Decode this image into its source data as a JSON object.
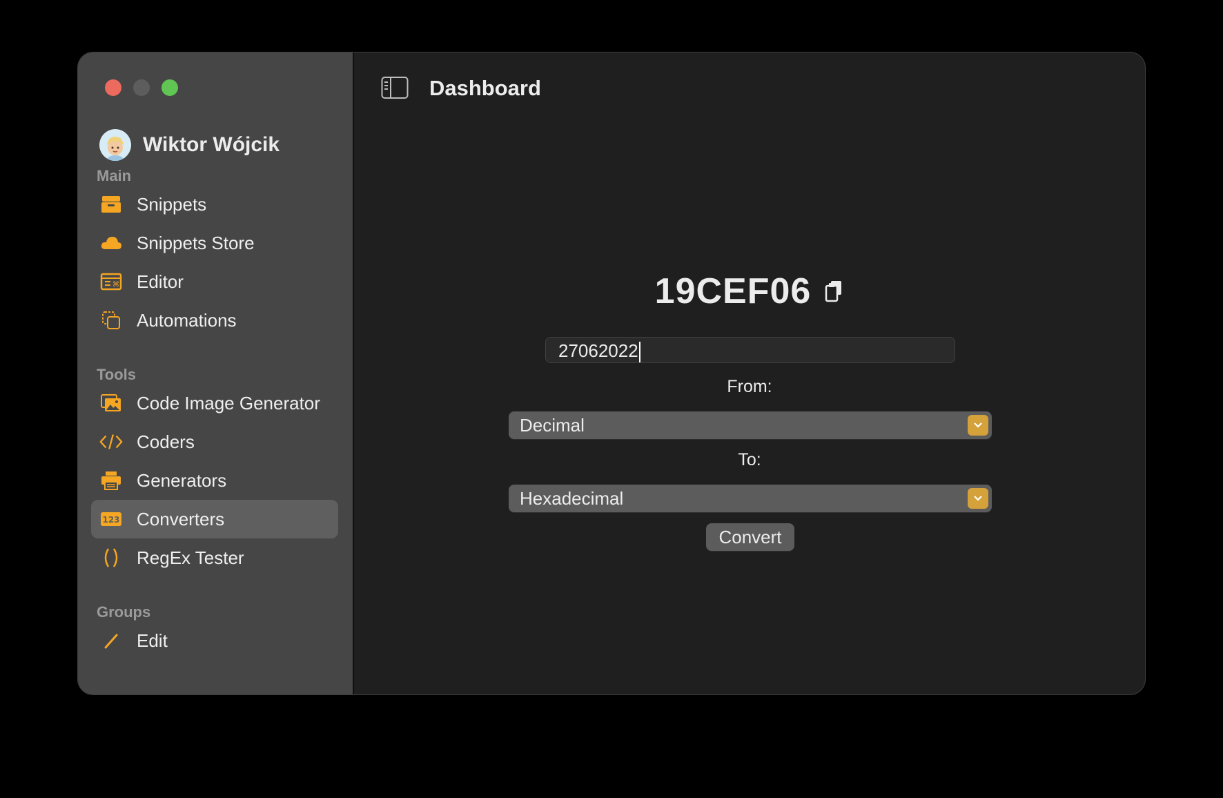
{
  "user": {
    "name": "Wiktor Wójcik"
  },
  "sidebar": {
    "sections": [
      {
        "title": "Main",
        "items": [
          {
            "label": "Snippets",
            "icon": "tray-icon"
          },
          {
            "label": "Snippets Store",
            "icon": "cloud-icon"
          },
          {
            "label": "Editor",
            "icon": "editor-window-icon"
          },
          {
            "label": "Automations",
            "icon": "automation-icon"
          }
        ]
      },
      {
        "title": "Tools",
        "items": [
          {
            "label": "Code Image Generator",
            "icon": "photo-stack-icon"
          },
          {
            "label": "Coders",
            "icon": "code-brackets-icon"
          },
          {
            "label": "Generators",
            "icon": "printer-icon"
          },
          {
            "label": "Converters",
            "icon": "numbers-123-icon",
            "active": true
          },
          {
            "label": "RegEx Tester",
            "icon": "parentheses-icon"
          }
        ]
      },
      {
        "title": "Groups",
        "items": [
          {
            "label": "Edit",
            "icon": "pencil-icon"
          }
        ]
      }
    ]
  },
  "header": {
    "title": "Dashboard"
  },
  "converter": {
    "result": "19CEF06",
    "input_value": "27062022",
    "from_label": "From:",
    "from_value": "Decimal",
    "to_label": "To:",
    "to_value": "Hexadecimal",
    "convert_label": "Convert"
  },
  "colors": {
    "accent": "#f5a623",
    "select_chevron": "#d4a13a"
  }
}
